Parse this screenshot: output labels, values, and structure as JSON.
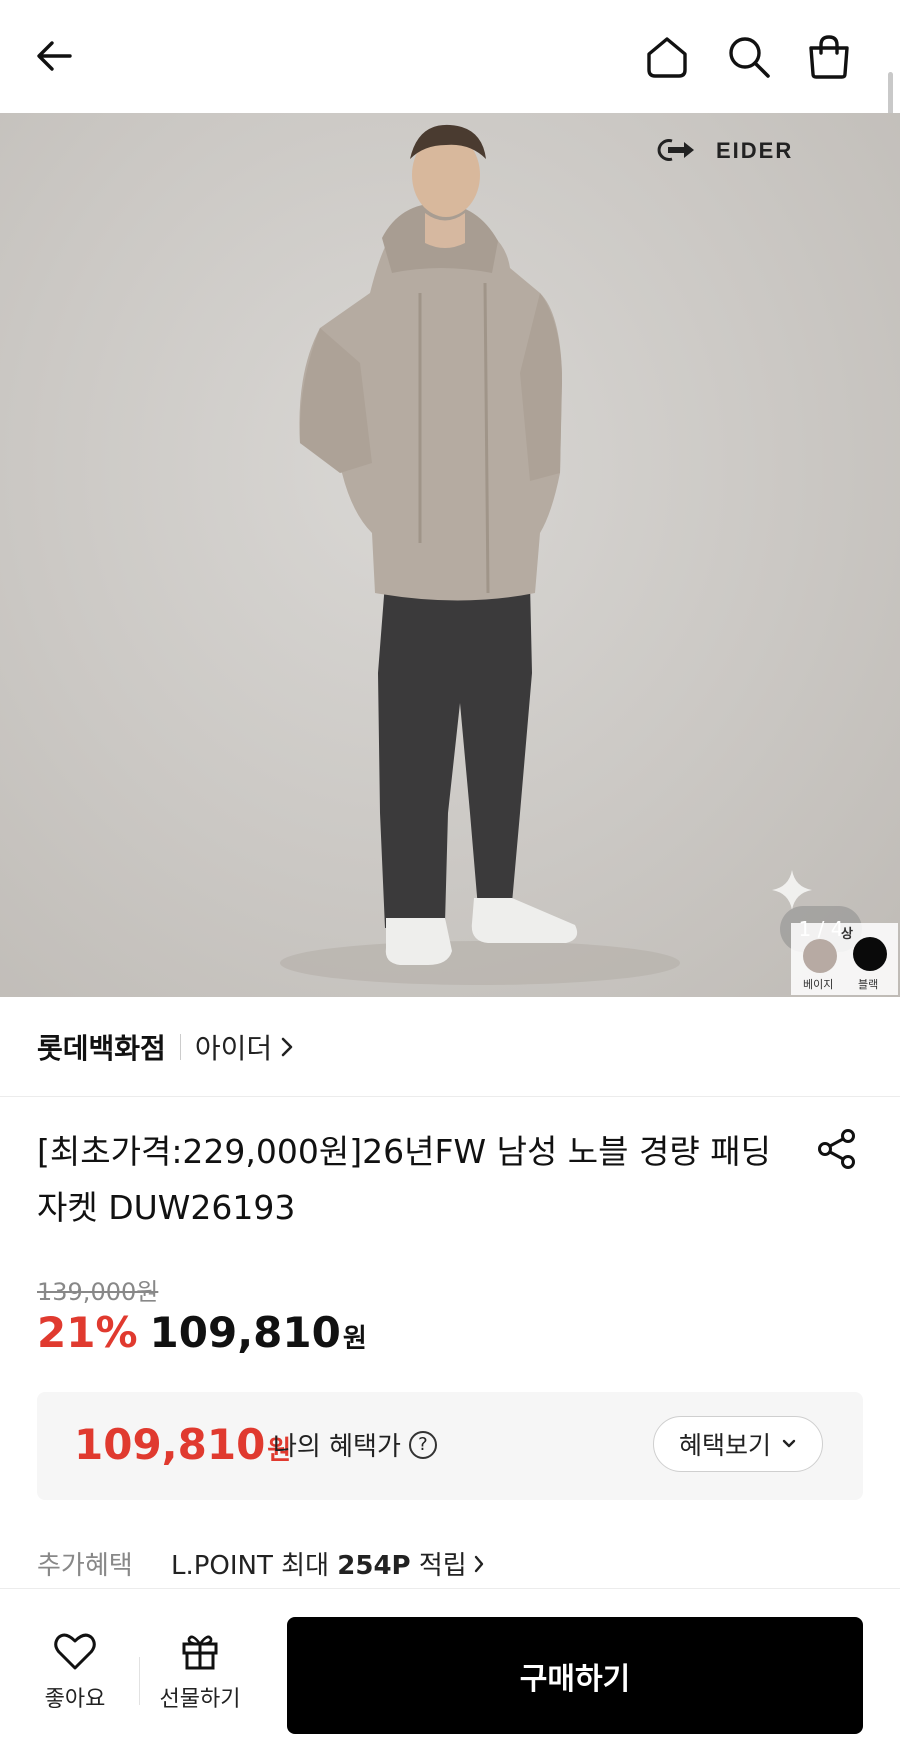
{
  "header": {
    "back_icon": "arrow-left-icon",
    "home_icon": "home-icon",
    "search_icon": "search-icon",
    "bag_icon": "shopping-bag-icon"
  },
  "hero": {
    "brand_logo": "EIDER",
    "counter": "1 / 4",
    "color_swatches": [
      {
        "label": "베이지",
        "color": "#b7aaa3"
      },
      {
        "label": "블랙",
        "color": "#0a0a0a"
      }
    ],
    "swatch_more": "상"
  },
  "store": {
    "name": "롯데백화점",
    "brand": "아이더"
  },
  "product": {
    "title": "[최초가격:229,000원]26년FW 남성 노블 경량 패딩 자켓 DUW26193"
  },
  "price": {
    "original": "139,000원",
    "discount": "21%",
    "sale": "109,810",
    "unit": "원",
    "discount_color": "#e03a2f"
  },
  "benefit": {
    "price": "109,810",
    "unit": "원",
    "label": "나의 혜택가",
    "help": "?",
    "button_label": "혜택보기"
  },
  "extra": {
    "label": "추가혜택",
    "text_prefix": "L.POINT 최대 ",
    "points": "254P",
    "text_suffix": " 적립"
  },
  "bottom_bar": {
    "like_label": "좋아요",
    "gift_label": "선물하기",
    "buy_label": "구매하기"
  }
}
